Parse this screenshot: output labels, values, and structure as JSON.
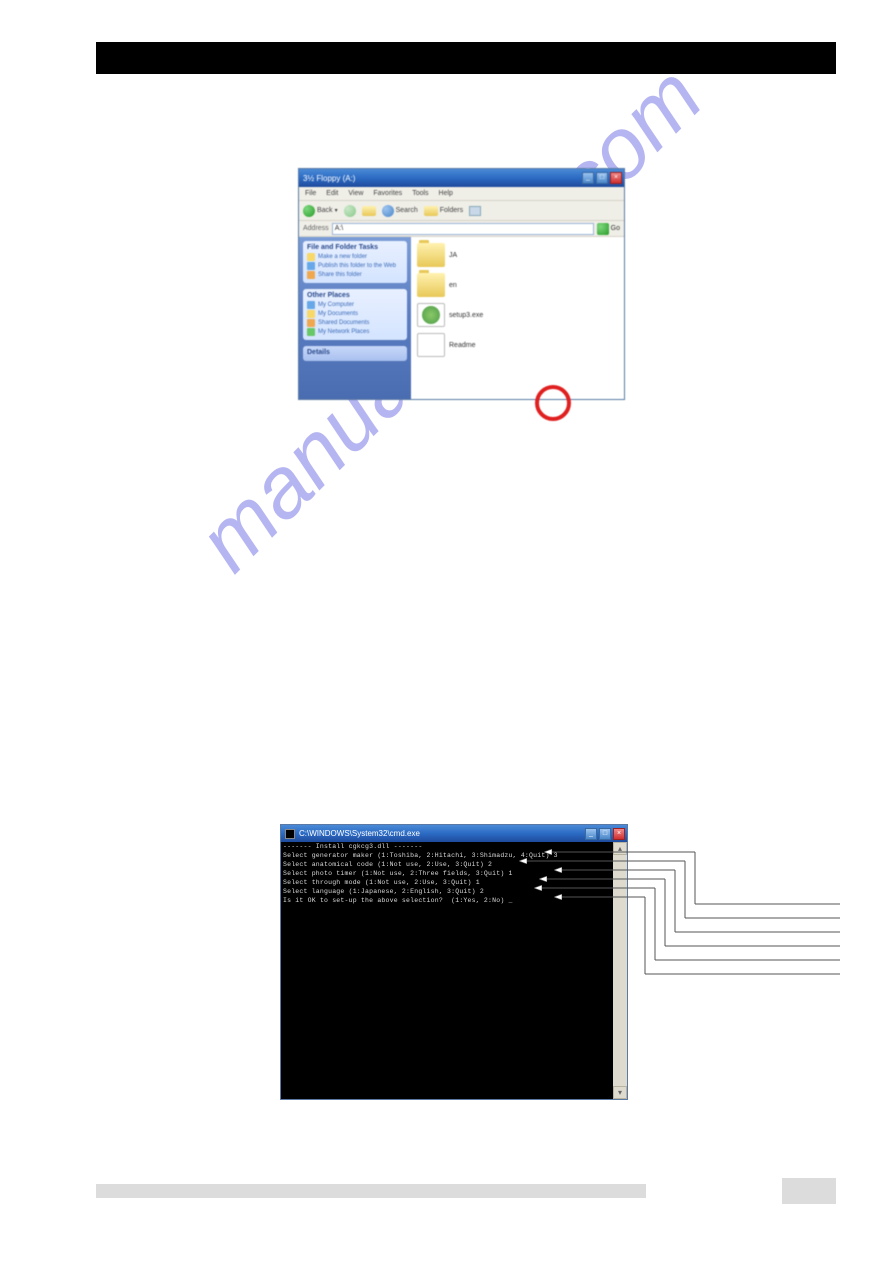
{
  "header": {
    "title": ""
  },
  "watermark": "manualshive.com",
  "explorer": {
    "title": "3½ Floppy (A:)",
    "menu": [
      "File",
      "Edit",
      "View",
      "Favorites",
      "Tools",
      "Help"
    ],
    "toolbar": {
      "back": "Back",
      "search": "Search",
      "folders": "Folders"
    },
    "address": "A:\\",
    "go": "Go",
    "sidebar": {
      "panel1": {
        "title": "File and Folder Tasks",
        "items": [
          "Make a new folder",
          "Publish this folder to the Web",
          "Share this folder"
        ]
      },
      "panel2": {
        "title": "Other Places",
        "items": [
          "My Computer",
          "My Documents",
          "Shared Documents",
          "My Network Places"
        ]
      },
      "panel3": {
        "title": "Details"
      }
    },
    "files": {
      "f1": "JA",
      "f2": "en",
      "f3": "setup3.exe",
      "f4": "Readme"
    }
  },
  "cmd": {
    "title": "C:\\WINDOWS\\System32\\cmd.exe",
    "lines": {
      "l0": "------- Install cgkcg3.dll -------",
      "l1": "Select generator maker (1:Toshiba, 2:Hitachi, 3:Shimadzu, 4:Quit) 3",
      "l2": "Select anatomical code (1:Not use, 2:Use, 3:Quit) 2",
      "l3": "Select photo timer (1:Not use, 2:Three fields, 3:Quit) 1",
      "l4": "Select through mode (1:Not use, 2:Use, 3:Quit) 1",
      "l5": "Select language (1:Japanese, 2:English, 3:Quit) 2",
      "l6": "Is it OK to set-up the above selection?  (1:Yes, 2:No) _"
    }
  }
}
